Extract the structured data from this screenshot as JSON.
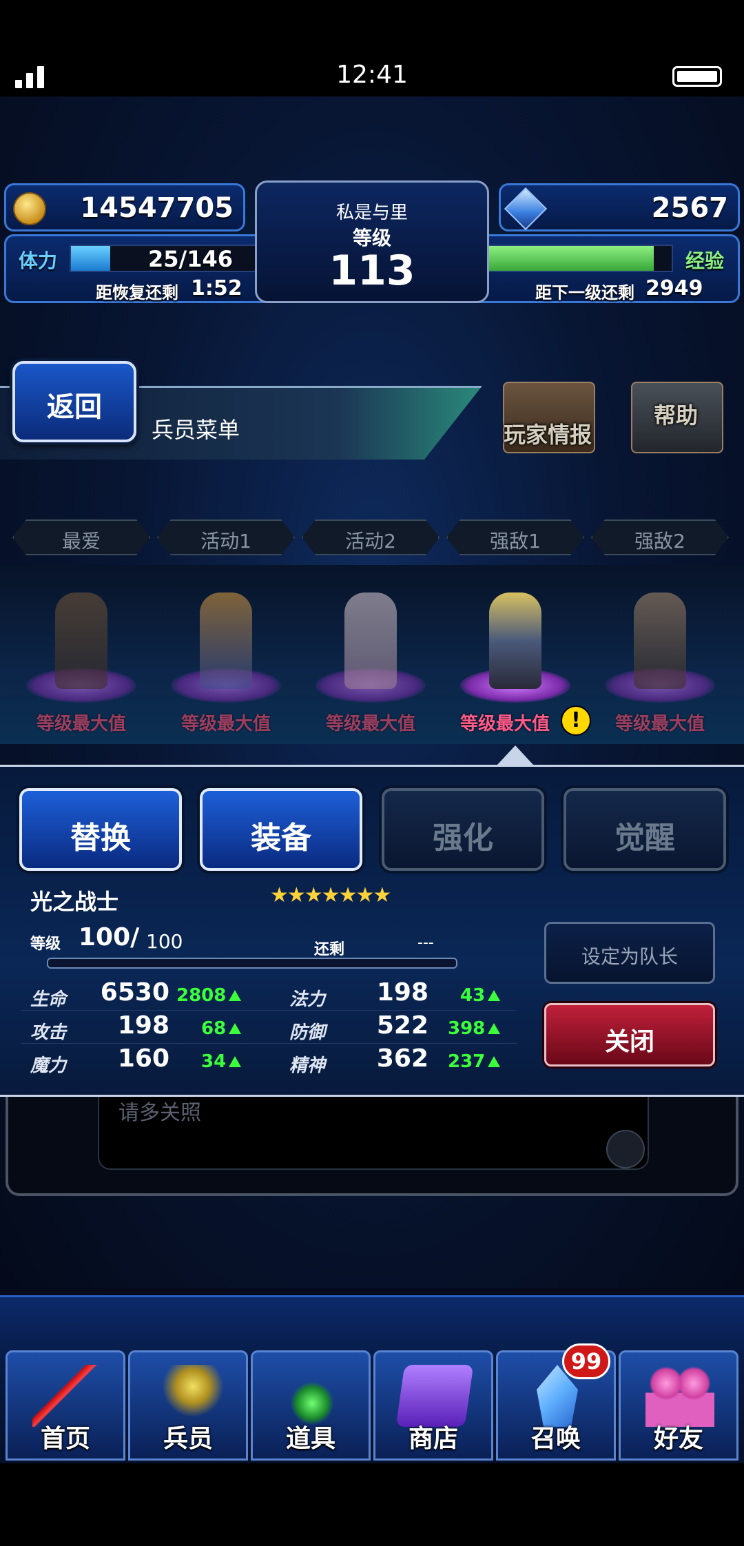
{
  "status_bar": {
    "time": "12:41"
  },
  "hud": {
    "gil": "14547705",
    "crystals": "2567",
    "player_name": "私是与里",
    "level_label": "等级",
    "level": "113",
    "stamina_label": "体力",
    "stamina": "25/146",
    "stamina_fraction": 0.17,
    "recover_label": "距恢复还剩",
    "recover_time": "1:52",
    "exp_label": "经验",
    "exp_fraction": 0.92,
    "next_label": "距下一级还剩",
    "next_exp": "2949"
  },
  "header": {
    "back_label": "返回",
    "title": "兵员菜单",
    "player_info_label": "玩家情报",
    "help_label": "帮助"
  },
  "party_tabs": [
    "最爱",
    "活动1",
    "活动2",
    "强敌1",
    "强敌2"
  ],
  "units": [
    {
      "label": "等级最大值",
      "active": false
    },
    {
      "label": "等级最大值",
      "active": false
    },
    {
      "label": "等级最大值",
      "active": false
    },
    {
      "label": "等级最大值",
      "active": true,
      "alert": "!"
    },
    {
      "label": "等级最大值",
      "active": false
    }
  ],
  "actions": [
    "替换",
    "装备",
    "强化",
    "觉醒"
  ],
  "unit_detail": {
    "name": "光之战士",
    "rarity_stars": "★★★★★★★",
    "level_label": "等级",
    "level": "100/",
    "level_max": "100",
    "remaining_label": "还剩",
    "remaining_value": "---",
    "stats": [
      {
        "label": "生命",
        "value": "6530",
        "bonus": "2808",
        "label2": "法力",
        "value2": "198",
        "bonus2": "43"
      },
      {
        "label": "攻击",
        "value": "198",
        "bonus": "68",
        "label2": "防御",
        "value2": "522",
        "bonus2": "398"
      },
      {
        "label": "魔力",
        "value": "160",
        "bonus": "34",
        "label2": "精神",
        "value2": "362",
        "bonus2": "237"
      }
    ],
    "set_leader_label": "设定为队长",
    "close_label": "关闭"
  },
  "message": {
    "text": "请多关照"
  },
  "nav": {
    "items": [
      "首页",
      "兵员",
      "道具",
      "商店",
      "召唤",
      "好友"
    ],
    "summon_badge": "99"
  },
  "colors": {
    "accent_blue": "#1d5fd8",
    "exp_green": "#5ed85a",
    "stamina_blue": "#25a8f0",
    "max_level_pink": "#ff4a6a",
    "close_red": "#c0203a",
    "bonus_green": "#3cff3c"
  }
}
